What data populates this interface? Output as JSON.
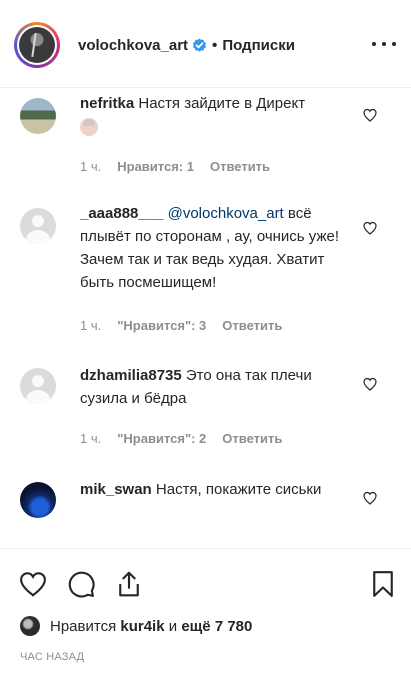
{
  "header": {
    "username": "volochkova_art",
    "separator": "•",
    "follow_label": "Подписки"
  },
  "comments": [
    {
      "user": "nefritka",
      "text": "Настя зайдите в Директ",
      "time": "1 ч.",
      "likes": "Нравится: 1",
      "reply": "Ответить"
    },
    {
      "user": "_aaa888___",
      "mention": "@volochkova_art",
      "text": "всё плывёт по сторонам , ау, очнись уже! Зачем так и так ведь худая. Хватит быть посмешищем!",
      "time": "1 ч.",
      "likes": "\"Нравится\": 3",
      "reply": "Ответить"
    },
    {
      "user": "dzhamilia8735",
      "text": "Это она так плечи сузила и бёдра",
      "time": "1 ч.",
      "likes": "\"Нравится\": 2",
      "reply": "Ответить"
    },
    {
      "user": "mik_swan",
      "text": "Настя, покажите сиськи"
    }
  ],
  "likes_summary": {
    "prefix": "Нравится",
    "user": "kur4ik",
    "conj": "и",
    "others": "ещё 7 780"
  },
  "timestamp": "ЧАС НАЗАД",
  "icons": {
    "like": "heart-icon",
    "comment": "comment-icon",
    "share": "share-icon",
    "save": "bookmark-icon",
    "more": "more-icon",
    "verified": "verified-badge-icon"
  },
  "colors": {
    "text": "#262626",
    "secondary": "#8e8e8e",
    "mention": "#00376b",
    "verified": "#3897f0"
  }
}
